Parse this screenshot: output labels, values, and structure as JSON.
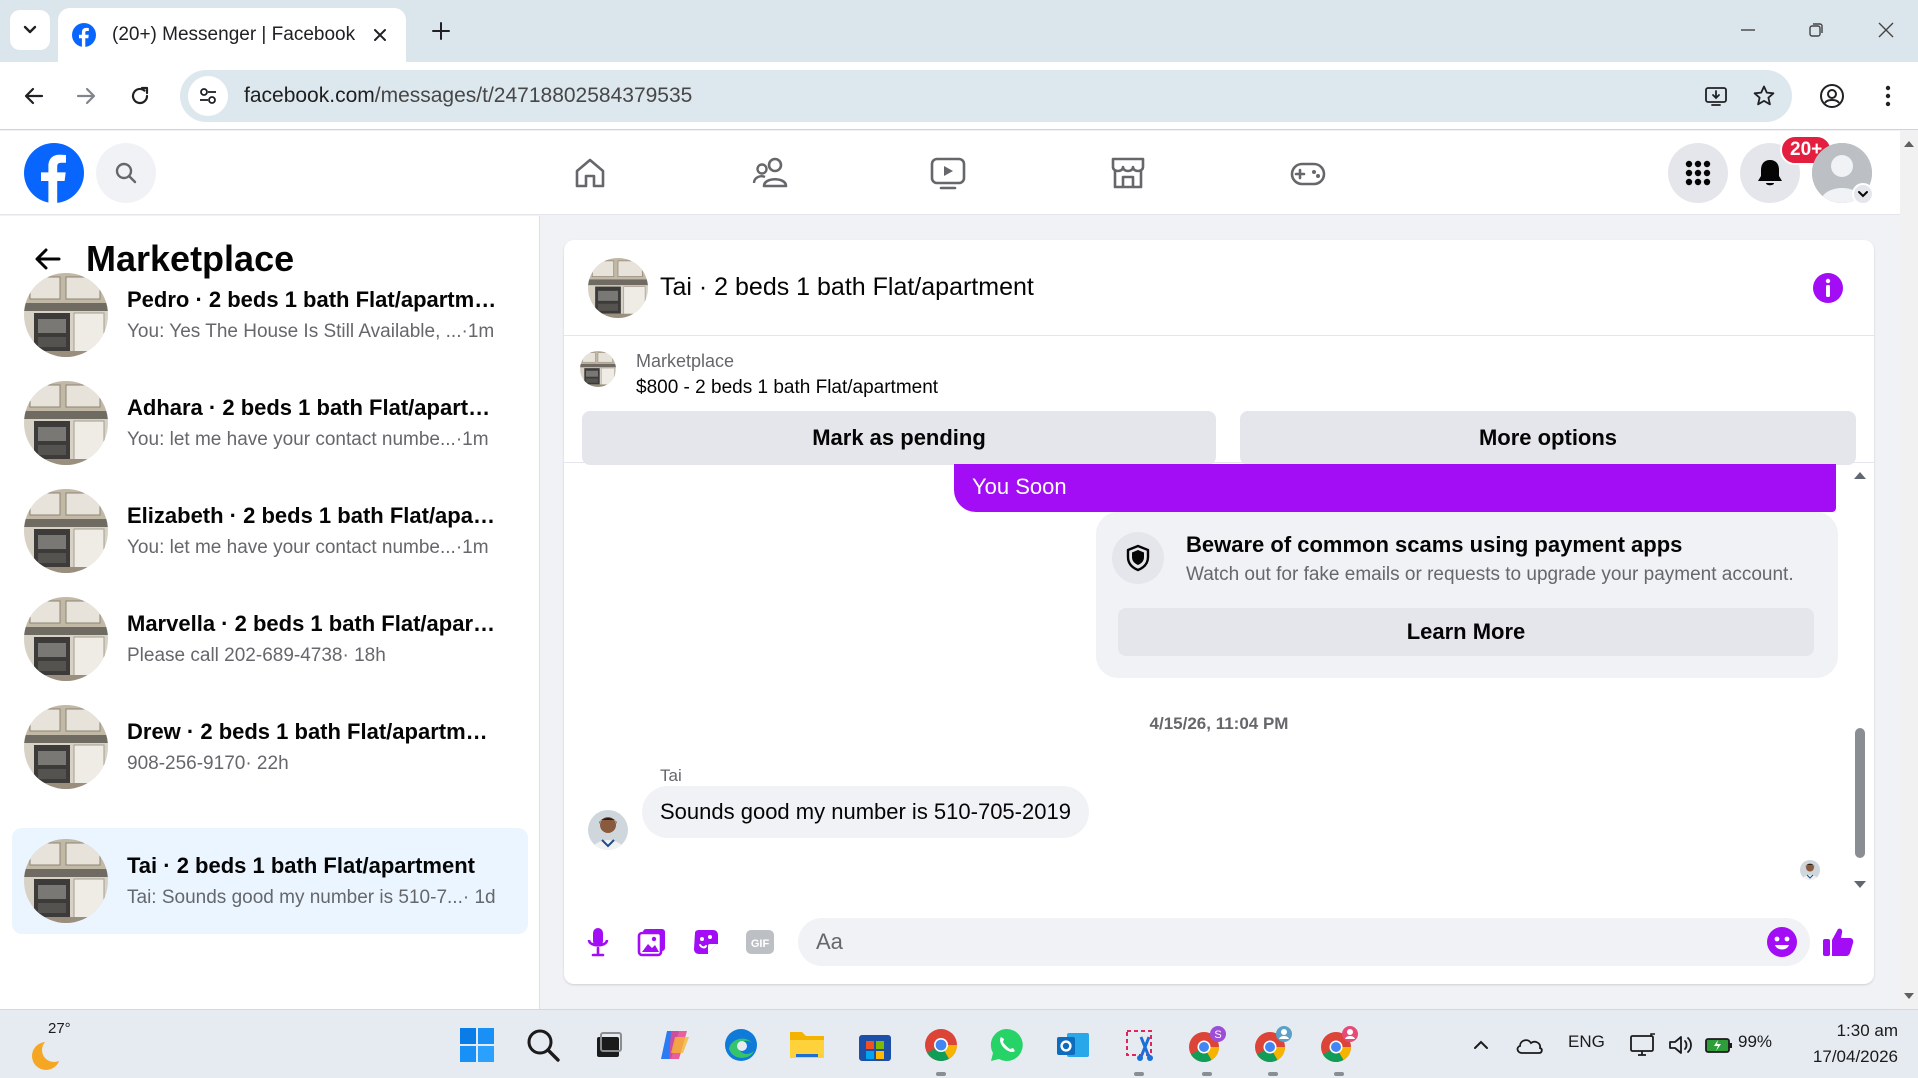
{
  "browser": {
    "tab_title": "(20+) Messenger | Facebook",
    "url_domain": "facebook.com",
    "url_path": "/messages/t/24718802584379535"
  },
  "fb": {
    "notification_badge": "20+"
  },
  "sidebar": {
    "title": "Marketplace",
    "conversations": [
      {
        "name": "Pedro · 2 beds 1 bath Flat/apartment",
        "preview": "You: Yes The House Is Still Available, ...",
        "time": " ·1m",
        "active": false
      },
      {
        "name": "Adhara · 2 beds 1 bath Flat/apartm...",
        "preview": "You: let me have your contact numbe...",
        "time": " ·1m",
        "active": false
      },
      {
        "name": "Elizabeth · 2 beds 1 bath Flat/apart...",
        "preview": "You: let me have your contact numbe...",
        "time": " ·1m",
        "active": false
      },
      {
        "name": "Marvella · 2 beds 1 bath Flat/apart...",
        "preview": "Please call 202-689-4738",
        "time": " · 18h",
        "active": false
      },
      {
        "name": "Drew · 2 beds 1 bath Flat/apartment",
        "preview": "908-256-9170",
        "time": " · 22h",
        "active": false
      },
      {
        "name": "Tai · 2 beds 1 bath Flat/apartment",
        "preview": "Tai: Sounds good my number is 510-7...",
        "time": " · 1d",
        "active": true
      }
    ]
  },
  "chat": {
    "title": "Tai · 2 beds 1 bath Flat/apartment",
    "listing_source": "Marketplace",
    "listing_price": "$800 - 2 beds 1 bath Flat/apartment",
    "mark_pending_label": "Mark as pending",
    "more_options_label": "More options",
    "outgoing_tail_text": "You Soon",
    "scam_title": "Beware of common scams using payment apps",
    "scam_subtitle": "Watch out for fake emails or requests to upgrade your payment account.",
    "learn_more_label": "Learn More",
    "timestamp": "4/15/26, 11:04 PM",
    "incoming_sender": "Tai",
    "incoming_message": "Sounds good my number is 510-705-2019",
    "composer_placeholder": "Aa",
    "accent_color": "#a20df5"
  },
  "taskbar": {
    "weather_temp": "27°",
    "language": "ENG",
    "battery": "99%",
    "time": "1:30 am",
    "date": "17/04/2026"
  }
}
